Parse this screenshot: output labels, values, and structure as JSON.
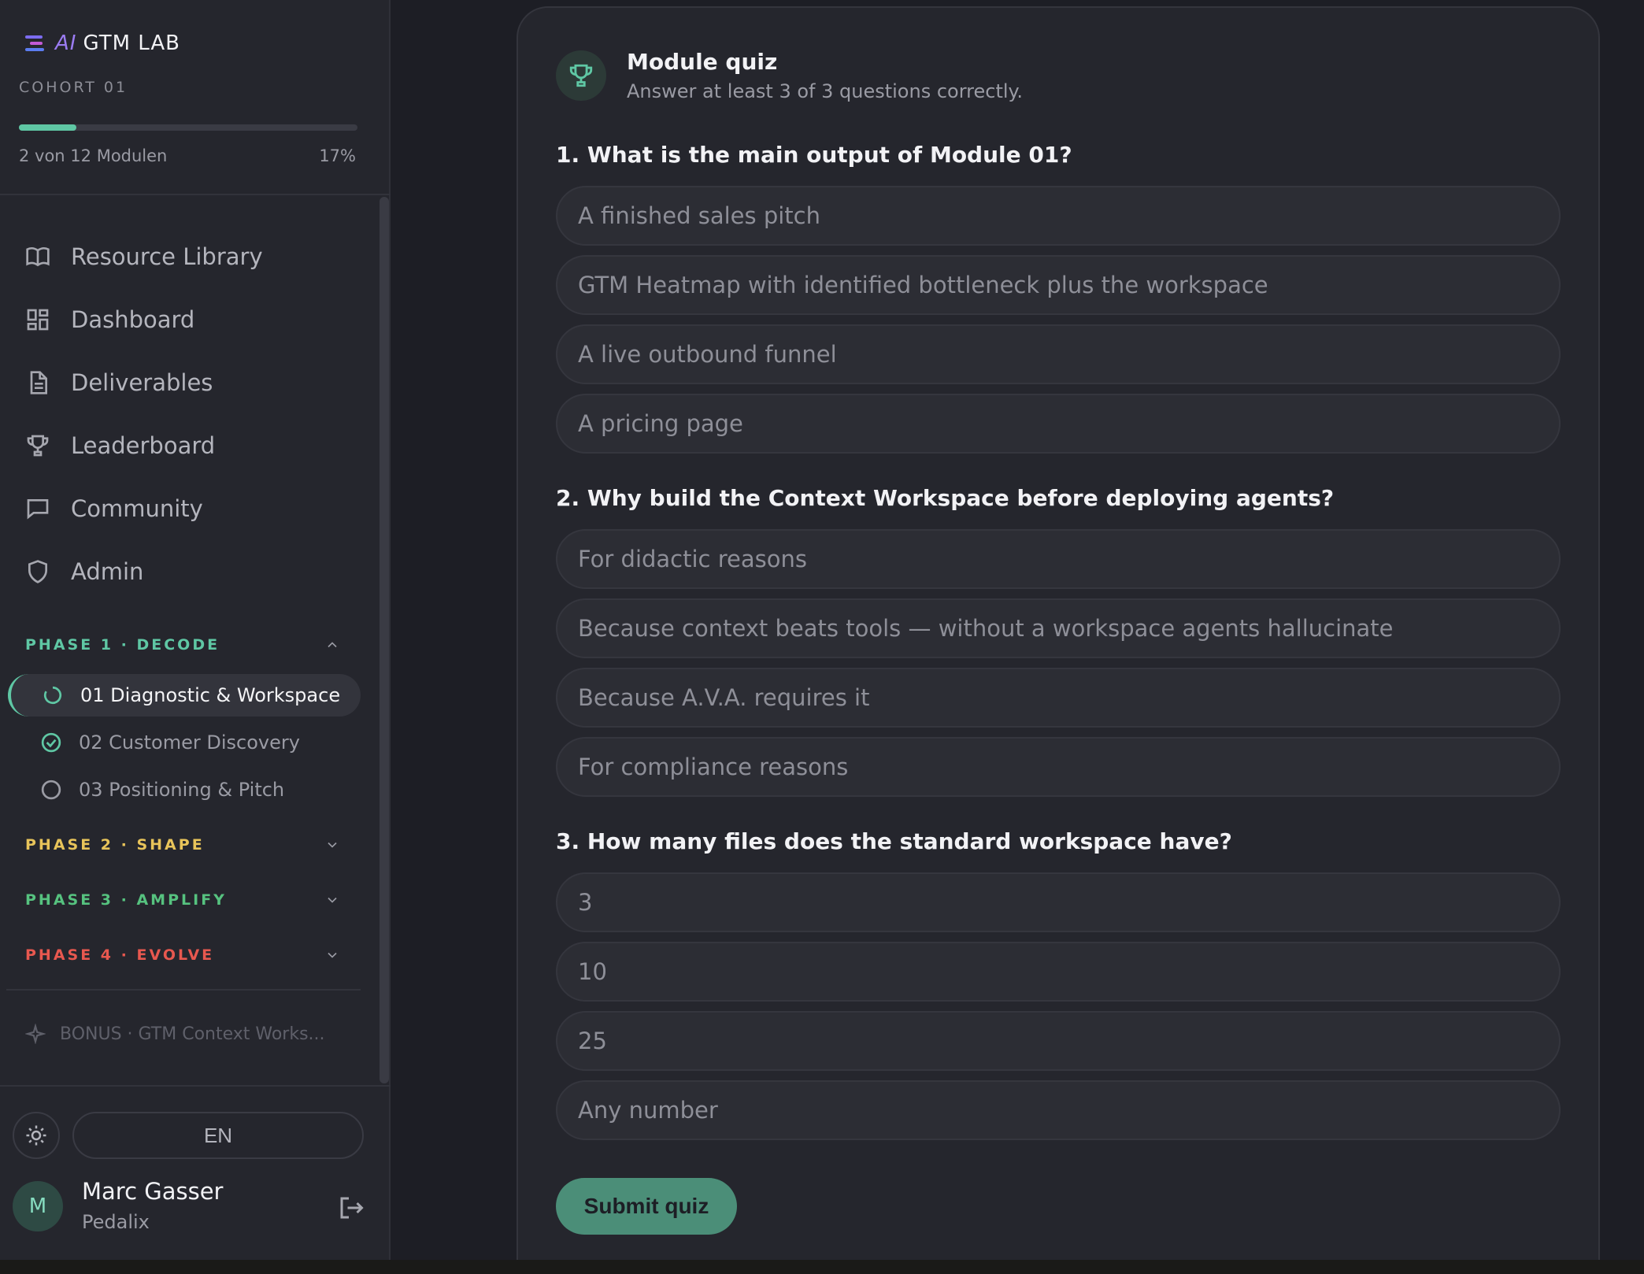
{
  "brand": {
    "ai": "AI",
    "name": "GTM LAB"
  },
  "cohort": "COHORT 01",
  "progress": {
    "label": "2 von 12 Modulen",
    "percent_text": "17%",
    "fraction": 0.17
  },
  "nav": [
    {
      "label": "Resource Library",
      "icon": "book-icon"
    },
    {
      "label": "Dashboard",
      "icon": "grid-icon"
    },
    {
      "label": "Deliverables",
      "icon": "document-icon"
    },
    {
      "label": "Leaderboard",
      "icon": "trophy-icon"
    },
    {
      "label": "Community",
      "icon": "chat-icon"
    },
    {
      "label": "Admin",
      "icon": "shield-icon"
    }
  ],
  "phases": [
    {
      "label": "PHASE 1 · DECODE",
      "color": "#5fc7a4",
      "expanded": true
    },
    {
      "label": "PHASE 2 · SHAPE",
      "color": "#e8c45a",
      "expanded": false
    },
    {
      "label": "PHASE 3 · AMPLIFY",
      "color": "#56c27f",
      "expanded": false
    },
    {
      "label": "PHASE 4 · EVOLVE",
      "color": "#e8584f",
      "expanded": false
    }
  ],
  "modules": [
    {
      "label": "01 Diagnostic & Workspace",
      "status": "in-progress"
    },
    {
      "label": "02 Customer Discovery",
      "status": "complete"
    },
    {
      "label": "03 Positioning & Pitch",
      "status": "not-started"
    }
  ],
  "bonus": "BONUS · GTM Context Works...",
  "language": "EN",
  "user": {
    "initial": "M",
    "name": "Marc Gasser",
    "org": "Pedalix"
  },
  "quiz": {
    "title": "Module quiz",
    "subtitle": "Answer at least 3 of 3 questions correctly.",
    "questions": [
      {
        "text": "1. What is the main output of Module 01?",
        "options": [
          "A finished sales pitch",
          "GTM Heatmap with identified bottleneck plus the workspace",
          "A live outbound funnel",
          "A pricing page"
        ]
      },
      {
        "text": "2. Why build the Context Workspace before deploying agents?",
        "options": [
          "For didactic reasons",
          "Because context beats tools — without a workspace agents hallucinate",
          "Because A.V.A. requires it",
          "For compliance reasons"
        ]
      },
      {
        "text": "3. How many files does the standard workspace have?",
        "options": [
          "3",
          "10",
          "25",
          "Any number"
        ]
      }
    ],
    "submit_label": "Submit quiz"
  },
  "colors": {
    "accent": "#5fc7a4",
    "submit": "#4b8e78"
  }
}
